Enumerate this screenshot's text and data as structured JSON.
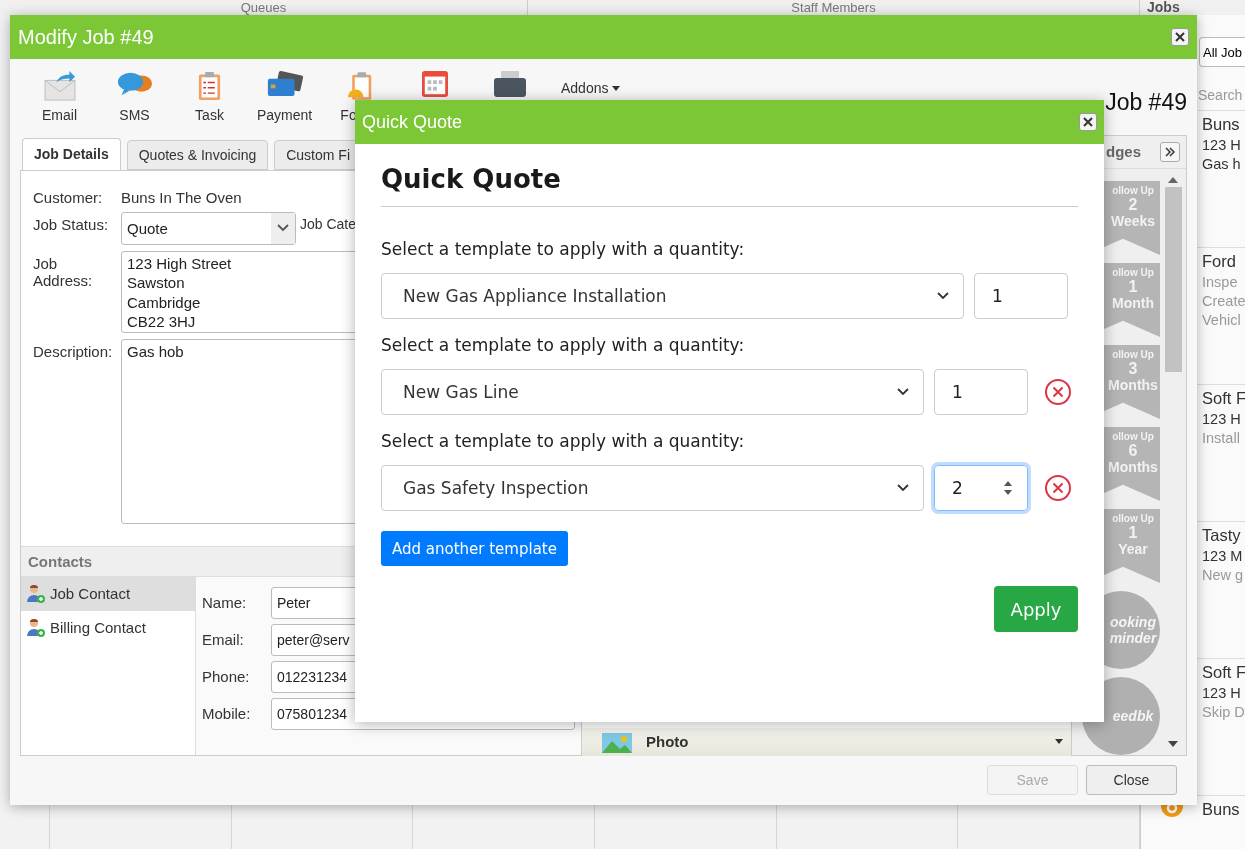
{
  "background": {
    "columns": [
      "Queues",
      "Staff Members"
    ],
    "jobs_panel": {
      "title": "Jobs",
      "filter": "All Job",
      "search": {
        "placeholder": "Search"
      },
      "jobs": [
        {
          "title": "Buns",
          "lines": [
            {
              "text": "123 H",
              "muted": false
            },
            {
              "text": "Gas h",
              "muted": false
            }
          ]
        },
        {
          "title": "Ford",
          "lines": [
            {
              "text": "Inspe",
              "muted": true
            },
            {
              "text": "Create",
              "muted": true
            },
            {
              "text": "Vehicl",
              "muted": true
            }
          ]
        },
        {
          "title": "Soft F",
          "lines": [
            {
              "text": "123 H",
              "muted": false
            },
            {
              "text": "Install",
              "muted": true
            }
          ]
        },
        {
          "title": "Tasty",
          "lines": [
            {
              "text": "123 M",
              "muted": false
            },
            {
              "text": "New g",
              "muted": true
            }
          ]
        },
        {
          "title": "Soft F",
          "lines": [
            {
              "text": "123 H",
              "muted": false
            },
            {
              "text": "Skip D",
              "muted": true
            }
          ]
        },
        {
          "title": "Buns"
        }
      ]
    }
  },
  "modify_job": {
    "title": "Modify Job #49",
    "heading": "Job #49",
    "toolbar": [
      {
        "kind": "email",
        "label": "Email"
      },
      {
        "kind": "sms",
        "label": "SMS"
      },
      {
        "kind": "task",
        "label": "Task"
      },
      {
        "kind": "payment",
        "label": "Payment"
      },
      {
        "kind": "form",
        "label": "Fo"
      },
      {
        "kind": "calendar"
      },
      {
        "kind": "print"
      }
    ],
    "addons": "Addons",
    "tabs": [
      {
        "label": "Job Details",
        "selected": true
      },
      {
        "label": "Quotes & Invoicing",
        "selected": false
      },
      {
        "label": "Custom Fi",
        "selected": false
      }
    ],
    "customer": {
      "label": "Customer:",
      "value": "Buns In The Oven"
    },
    "job_status": {
      "label": "Job Status:",
      "value": "Quote"
    },
    "job_category": {
      "label": "Job Cate"
    },
    "address": {
      "label": "Job Address:",
      "value": "123 High Street\nSawston\nCambridge\nCB22 3HJ"
    },
    "description": {
      "label": "Description:",
      "value": "Gas hob"
    },
    "contacts": {
      "title": "Contacts",
      "items": [
        {
          "label": "Job Contact",
          "selected": true
        },
        {
          "label": "Billing Contact",
          "selected": false
        }
      ],
      "fields": [
        {
          "label": "Name:",
          "value": "Peter"
        },
        {
          "label": "Email:",
          "value": "peter@serv"
        },
        {
          "label": "Phone:",
          "value": "012231234"
        },
        {
          "label": "Mobile:",
          "value": "075801234"
        }
      ]
    },
    "attachment": {
      "label": "Photo"
    },
    "badges": {
      "title": "dges",
      "items": [
        {
          "kind": "ribbon",
          "lines": [
            "ollow Up",
            "2",
            "Weeks"
          ]
        },
        {
          "kind": "ribbon",
          "lines": [
            "ollow Up",
            "1",
            "Month"
          ]
        },
        {
          "kind": "ribbon",
          "lines": [
            "ollow Up",
            "3",
            "Months"
          ]
        },
        {
          "kind": "ribbon",
          "lines": [
            "ollow Up",
            "6",
            "Months"
          ]
        },
        {
          "kind": "ribbon",
          "lines": [
            "ollow Up",
            "1",
            "Year"
          ]
        },
        {
          "kind": "circle",
          "lines": [
            "ooking",
            "minder"
          ]
        },
        {
          "kind": "circle",
          "lines": [
            "eedbk"
          ]
        }
      ]
    },
    "footer": [
      {
        "label": "Save",
        "disabled": true
      },
      {
        "label": "Close",
        "disabled": false
      }
    ]
  },
  "quick_quote": {
    "title": "Quick Quote",
    "heading": "Quick Quote",
    "rows": [
      {
        "label": "Select a template to apply with a quantity:",
        "template": "New Gas Appliance Installation",
        "quantity": "1",
        "removable": false,
        "focused": false
      },
      {
        "label": "Select a template to apply with a quantity:",
        "template": "New Gas Line",
        "quantity": "1",
        "removable": true,
        "focused": false
      },
      {
        "label": "Select a template to apply with a quantity:",
        "template": "Gas Safety Inspection",
        "quantity": "2",
        "removable": true,
        "focused": true
      }
    ],
    "add_button": "Add another template",
    "apply_button": "Apply"
  }
}
